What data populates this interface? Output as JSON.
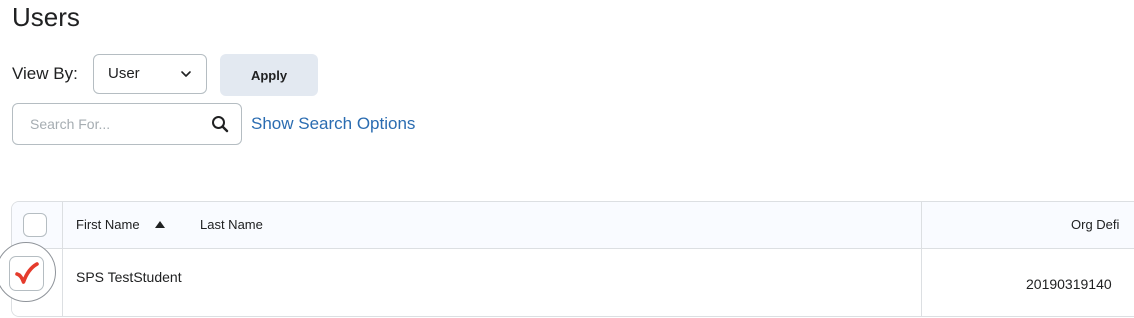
{
  "page": {
    "title": "Users"
  },
  "filters": {
    "view_by_label": "View By:",
    "view_by_value": "User",
    "apply_label": "Apply",
    "search_placeholder": "Search For...",
    "show_search_options": "Show Search Options"
  },
  "table": {
    "columns": [
      {
        "label": "First Name",
        "sort": "ascending"
      },
      {
        "label": "Last Name"
      },
      {
        "label": "Org Defi"
      }
    ],
    "select_all_checked": false,
    "rows": [
      {
        "name": "SPS TestStudent",
        "org_defined_id": "20190319140",
        "checked": true
      }
    ]
  },
  "colors": {
    "link": "#2a6cb1",
    "apply_bg": "#e3e9f1",
    "check": "#e53b2c",
    "header_bg": "#f9fbff"
  },
  "icons": {
    "search": "magnifier",
    "dropdown": "chevron-down",
    "sort": "triangle-up",
    "checked": "red-checkmark"
  }
}
